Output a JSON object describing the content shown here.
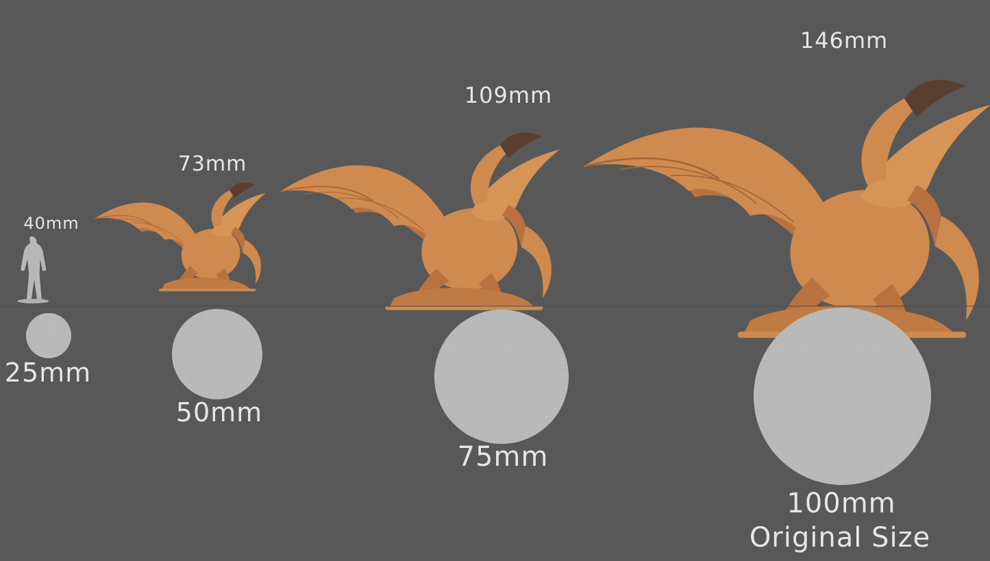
{
  "colors": {
    "background": "#585858",
    "model": "#cf8a4f",
    "model_dark": "#8a5230",
    "scale_ref": "#b8b8b8",
    "text": "#e6e6e6"
  },
  "heights": [
    {
      "label": "40mm"
    },
    {
      "label": "73mm"
    },
    {
      "label": "109mm"
    },
    {
      "label": "146mm"
    }
  ],
  "bases": [
    {
      "label": "25mm"
    },
    {
      "label": "50mm"
    },
    {
      "label": "75mm"
    },
    {
      "label": "100mm",
      "note": "Original Size"
    }
  ]
}
